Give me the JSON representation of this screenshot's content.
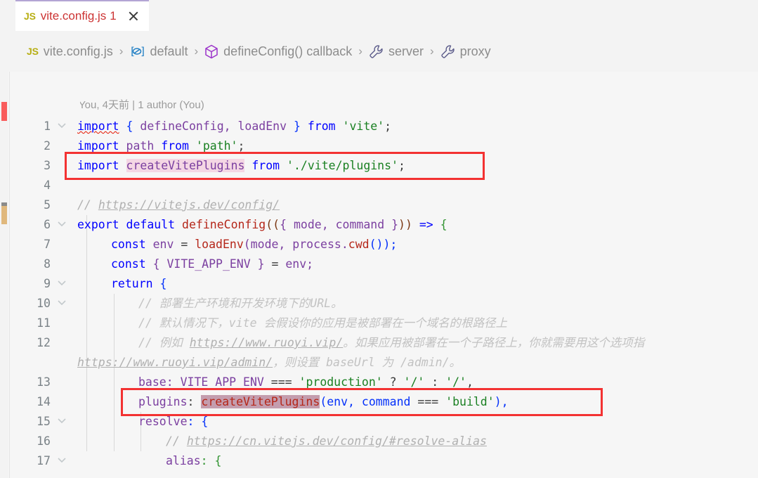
{
  "tab": {
    "icon": "js-file-icon",
    "icon_label": "JS",
    "filename": "vite.config.js",
    "problem_count": "1",
    "close_label": "×"
  },
  "breadcrumb": {
    "separator": "›",
    "items": [
      {
        "icon": "js-file-icon",
        "icon_label": "JS",
        "label": "vite.config.js"
      },
      {
        "icon": "module-icon",
        "label": "default"
      },
      {
        "icon": "cube-symbol-icon",
        "label": "defineConfig() callback"
      },
      {
        "icon": "wrench-property-icon",
        "label": "server"
      },
      {
        "icon": "wrench-property-icon",
        "label": "proxy"
      }
    ]
  },
  "blame": "You, 4天前 | 1 author (You)",
  "editor": {
    "line_numbers": [
      "1",
      "2",
      "3",
      "4",
      "5",
      "6",
      "7",
      "8",
      "9",
      "10",
      "11",
      "12",
      "13",
      "14",
      "15",
      "16",
      "17"
    ],
    "fold_lines": [
      "1",
      "6",
      "9",
      "10",
      "15",
      "17"
    ],
    "lines": {
      "l1": {
        "a": "import",
        "b": " ",
        "c": "{",
        "d": " defineConfig, loadEnv ",
        "e": "}",
        "f": " from ",
        "g": "'vite'",
        "h": ";"
      },
      "l2": {
        "a": "import",
        "b": " path ",
        "c": "from ",
        "d": "'path'",
        "e": ";"
      },
      "l3": {
        "a": "import",
        "b": " ",
        "hl": "createVitePlugins",
        "c": " from ",
        "d": "'./vite/plugins'",
        "e": ";"
      },
      "l5": {
        "a": "// ",
        "link": "https://vitejs.dev/config/"
      },
      "l6": {
        "a": "export",
        "b": " ",
        "c": "default",
        "d": " ",
        "fn": "defineConfig",
        "e": "((",
        "f": "{ mode, command }",
        "g": ")) ",
        "h": "=>",
        "i": " {"
      },
      "l7": {
        "a": "const",
        "b": " env ",
        "c": "=",
        "d": " ",
        "fn": "loadEnv",
        "e": "(mode, process.",
        "fn2": "cwd",
        "f": "());"
      },
      "l8": {
        "a": "const",
        "b": " { VITE_APP_ENV } ",
        "c": "=",
        "d": " env;"
      },
      "l9": {
        "a": "return",
        "b": " {"
      },
      "l10": {
        "a": "// 部署生产环境和开发环境下的URL。"
      },
      "l11": {
        "a": "// 默认情况下，vite 会假设你的应用是被部署在一个域名的根路径上"
      },
      "l12a": {
        "a": "// 例如 ",
        "link": "https://www.ruoyi.vip/",
        "b": "。如果应用被部署在一个子路径上，你就需要用这个选项指"
      },
      "l12b": {
        "link": "https://www.ruoyi.vip/admin/",
        "b": "，则设置 baseUrl 为 /admin/。"
      },
      "l13": {
        "a": "base",
        "b": ": VITE_APP_ENV ",
        "c": "===",
        "d": " ",
        "str": "'production'",
        "e": " ? ",
        "str2": "'/'",
        "f": " : ",
        "str3": "'/'",
        "g": ","
      },
      "l14": {
        "a": "plugins",
        "b": ": ",
        "hl": "createVitePlugins",
        "c": "(env, command ",
        "d": "===",
        "e": " ",
        "str": "'build'",
        "f": "),"
      },
      "l15": {
        "a": "resolve",
        "b": ": {"
      },
      "l16": {
        "a": "// ",
        "link": "https://cn.vitejs.dev/config/#resolve-alias"
      },
      "l17": {
        "a": "alias",
        "b": ": {"
      }
    }
  },
  "annotations": {
    "box_1_label": "highlight-box-import-line",
    "box_2_label": "highlight-box-plugins-line"
  },
  "colors": {
    "tab_active_border": "#b3a5d4",
    "error_text": "#cc3333",
    "annotation_box": "#f33232",
    "highlight_light": "#f4d7e4",
    "highlight_dark": "#c49dae",
    "ruler_error": "#f95c5c",
    "ruler_modified": "#e0b87d"
  }
}
